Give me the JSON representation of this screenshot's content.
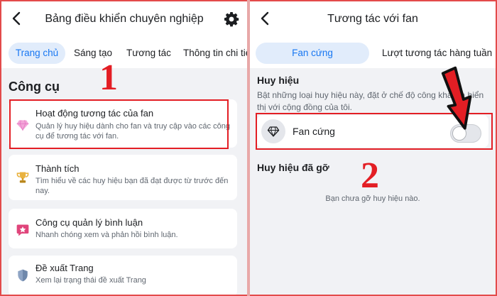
{
  "left": {
    "title": "Bảng điều khiển chuyên nghiệp",
    "tabs": [
      "Trang chủ",
      "Sáng tạo",
      "Tương tác",
      "Thông tin chi tiết"
    ],
    "section": "Công cụ",
    "step_number": "1",
    "cards": [
      {
        "title": "Hoạt động tương tác của fan",
        "desc": "Quản lý huy hiệu dành cho fan và truy cập vào các công cụ để tương tác với fan.",
        "icon": "diamond-icon"
      },
      {
        "title": "Thành tích",
        "desc": "Tìm hiểu về các huy hiệu bạn đã đạt được từ trước đến nay.",
        "icon": "trophy-icon"
      },
      {
        "title": "Công cụ quản lý bình luận",
        "desc": "Nhanh chóng xem và phản hồi bình luận.",
        "icon": "comment-star-icon"
      },
      {
        "title": "Đề xuất Trang",
        "desc": "Xem lại trạng thái đề xuất Trang",
        "icon": "shield-icon"
      }
    ]
  },
  "right": {
    "title": "Tương tác với fan",
    "tabs": [
      "Fan cứng",
      "Lượt tương tác hàng tuần"
    ],
    "badge_section": "Huy hiệu",
    "badge_desc": "Bật những loại huy hiệu này, đặt ở chế độ công khai và hiển thị với cộng đồng của tôi.",
    "fan_label": "Fan cứng",
    "fan_toggle_on": false,
    "step_number": "2",
    "removed_section": "Huy hiệu đã gỡ",
    "removed_empty": "Bạn chưa gỡ huy hiệu nào."
  },
  "colors": {
    "accent": "#1877f2",
    "highlight": "#e31e24",
    "background": "#f1f2f5"
  }
}
